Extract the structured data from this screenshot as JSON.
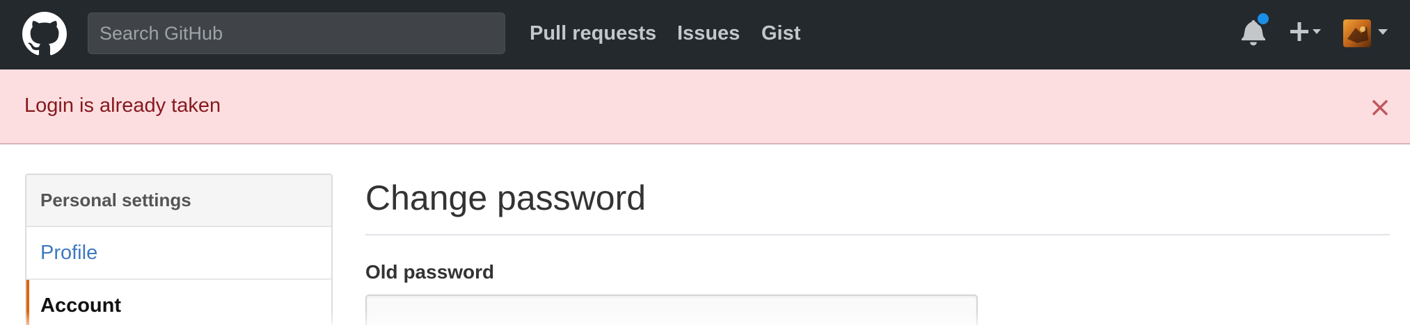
{
  "header": {
    "logo_icon": "github-octocat-icon",
    "search": {
      "placeholder": "Search GitHub",
      "value": ""
    },
    "nav": [
      {
        "label": "Pull requests"
      },
      {
        "label": "Issues"
      },
      {
        "label": "Gist"
      }
    ],
    "notifications": {
      "icon": "bell-icon",
      "unread_indicator_color": "#1b8ee6"
    },
    "create_menu": {
      "icon": "plus-icon"
    },
    "user_menu": {
      "icon": "avatar"
    }
  },
  "flash": {
    "message": "Login is already taken",
    "close_icon": "close-icon",
    "background": "#fcdee0",
    "text_color": "#86181d"
  },
  "sidebar": {
    "heading": "Personal settings",
    "items": [
      {
        "label": "Profile",
        "active": false
      },
      {
        "label": "Account",
        "active": true
      }
    ],
    "active_accent": "#e36209"
  },
  "main": {
    "title": "Change password",
    "fields": [
      {
        "label": "Old password",
        "value": ""
      }
    ]
  }
}
